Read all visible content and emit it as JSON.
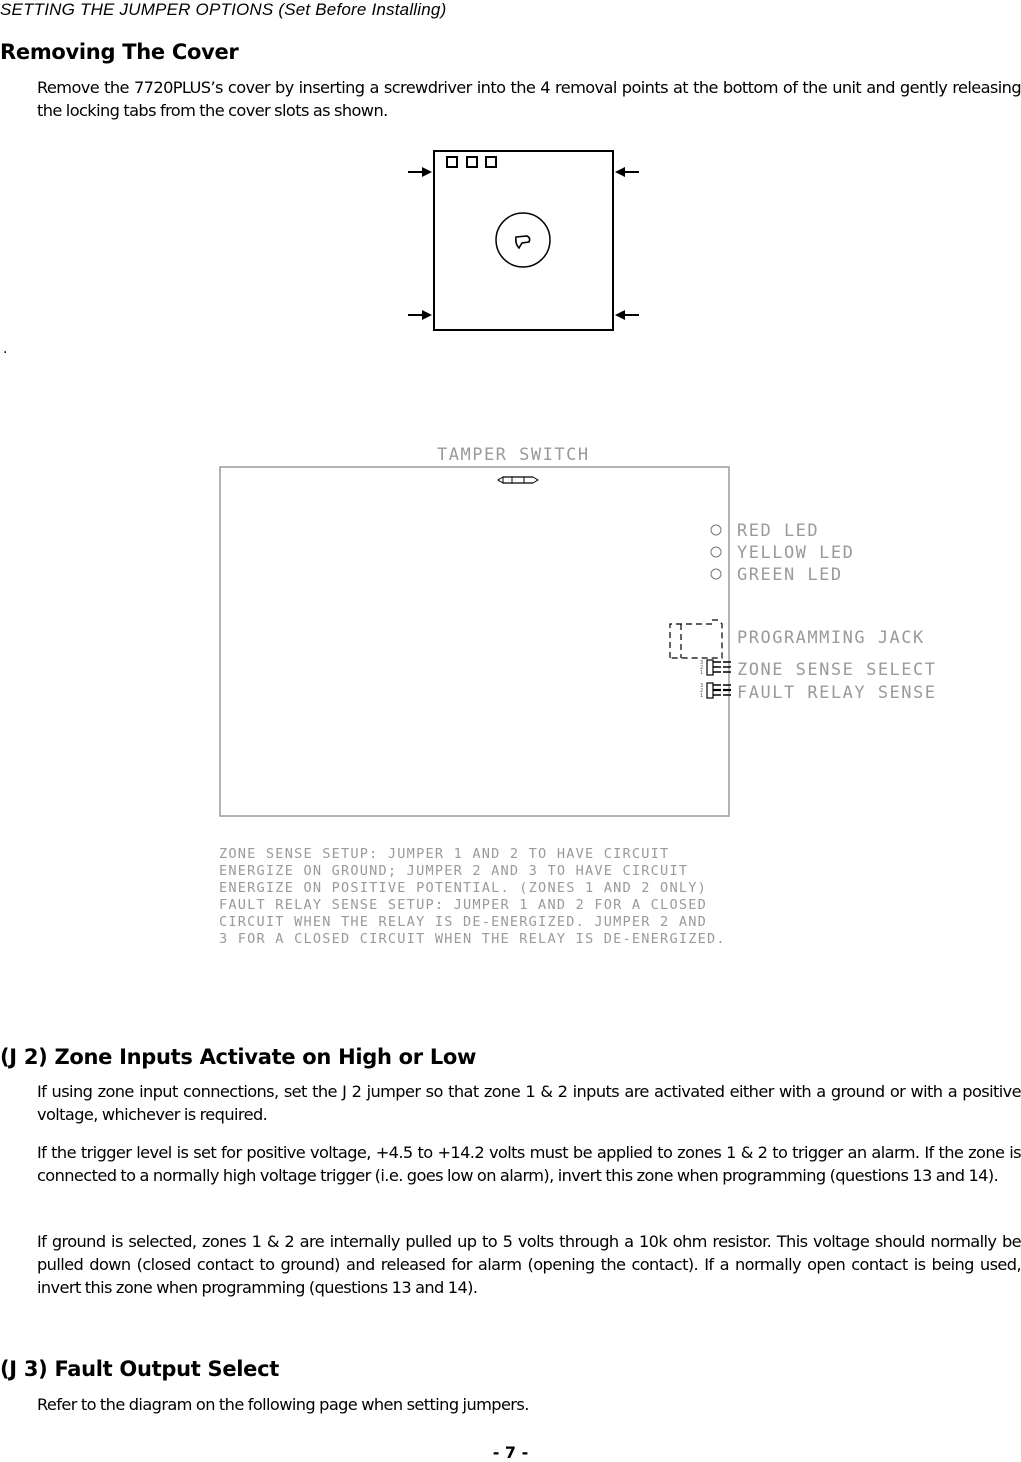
{
  "header": {
    "running_title": "SETTING THE JUMPER OPTIONS (Set Before Installing)"
  },
  "section_cover": {
    "heading": "Removing The Cover",
    "paragraph": "Remove the 7720PLUS’s cover by inserting a screwdriver into the 4 removal points at the bottom of the unit and gently releasing the locking tabs from the cover slots as shown."
  },
  "stray_mark": ".",
  "board_diagram": {
    "tamper_label": "TAMPER SWITCH",
    "leds": [
      "RED LED",
      "YELLOW LED",
      "GREEN LED"
    ],
    "programming_jack_label": "PROGRAMMING JACK",
    "zone_sense_label": "ZONE SENSE SELECT",
    "fault_relay_label": "FAULT RELAY SENSE",
    "pin_numbers": [
      "3",
      "2",
      "1"
    ],
    "notes": [
      "ZONE SENSE SETUP: JUMPER 1 AND 2 TO HAVE CIRCUIT",
      "ENERGIZE ON GROUND; JUMPER 2 AND 3 TO HAVE CIRCUIT",
      "ENERGIZE ON POSITIVE POTENTIAL.  (ZONES 1 AND 2 ONLY)",
      "FAULT RELAY SENSE SETUP: JUMPER 1 AND 2 FOR A CLOSED",
      "CIRCUIT WHEN THE RELAY IS DE-ENERGIZED. JUMPER 2 AND",
      "3 FOR A CLOSED CIRCUIT WHEN THE RELAY IS DE-ENERGIZED."
    ]
  },
  "section_j2": {
    "heading": "(J 2) Zone Inputs Activate on High or Low",
    "paragraphs": [
      "If using zone input connections, set the J 2 jumper so that zone 1 & 2 inputs are activated either with a ground or with a positive voltage, whichever is required.",
      "If the trigger level is set for positive voltage, +4.5 to +14.2 volts must be applied to zones 1 & 2 to trigger an alarm. If the zone is connected to a normally high voltage trigger (i.e. goes low on alarm), invert this zone when programming (questions  13 and 14).",
      "If ground is selected, zones 1 & 2 are internally pulled up to 5 volts through a 10k ohm resistor. This voltage should normally be pulled down (closed contact to ground) and released for alarm (opening the contact). If a normally open contact is being used, invert this zone when programming (questions 13 and 14)."
    ]
  },
  "section_j3": {
    "heading": "(J 3) Fault Output Select",
    "paragraph": "Refer to the diagram on the following page when setting jumpers."
  },
  "footer": {
    "page_number": "- 7 -"
  }
}
